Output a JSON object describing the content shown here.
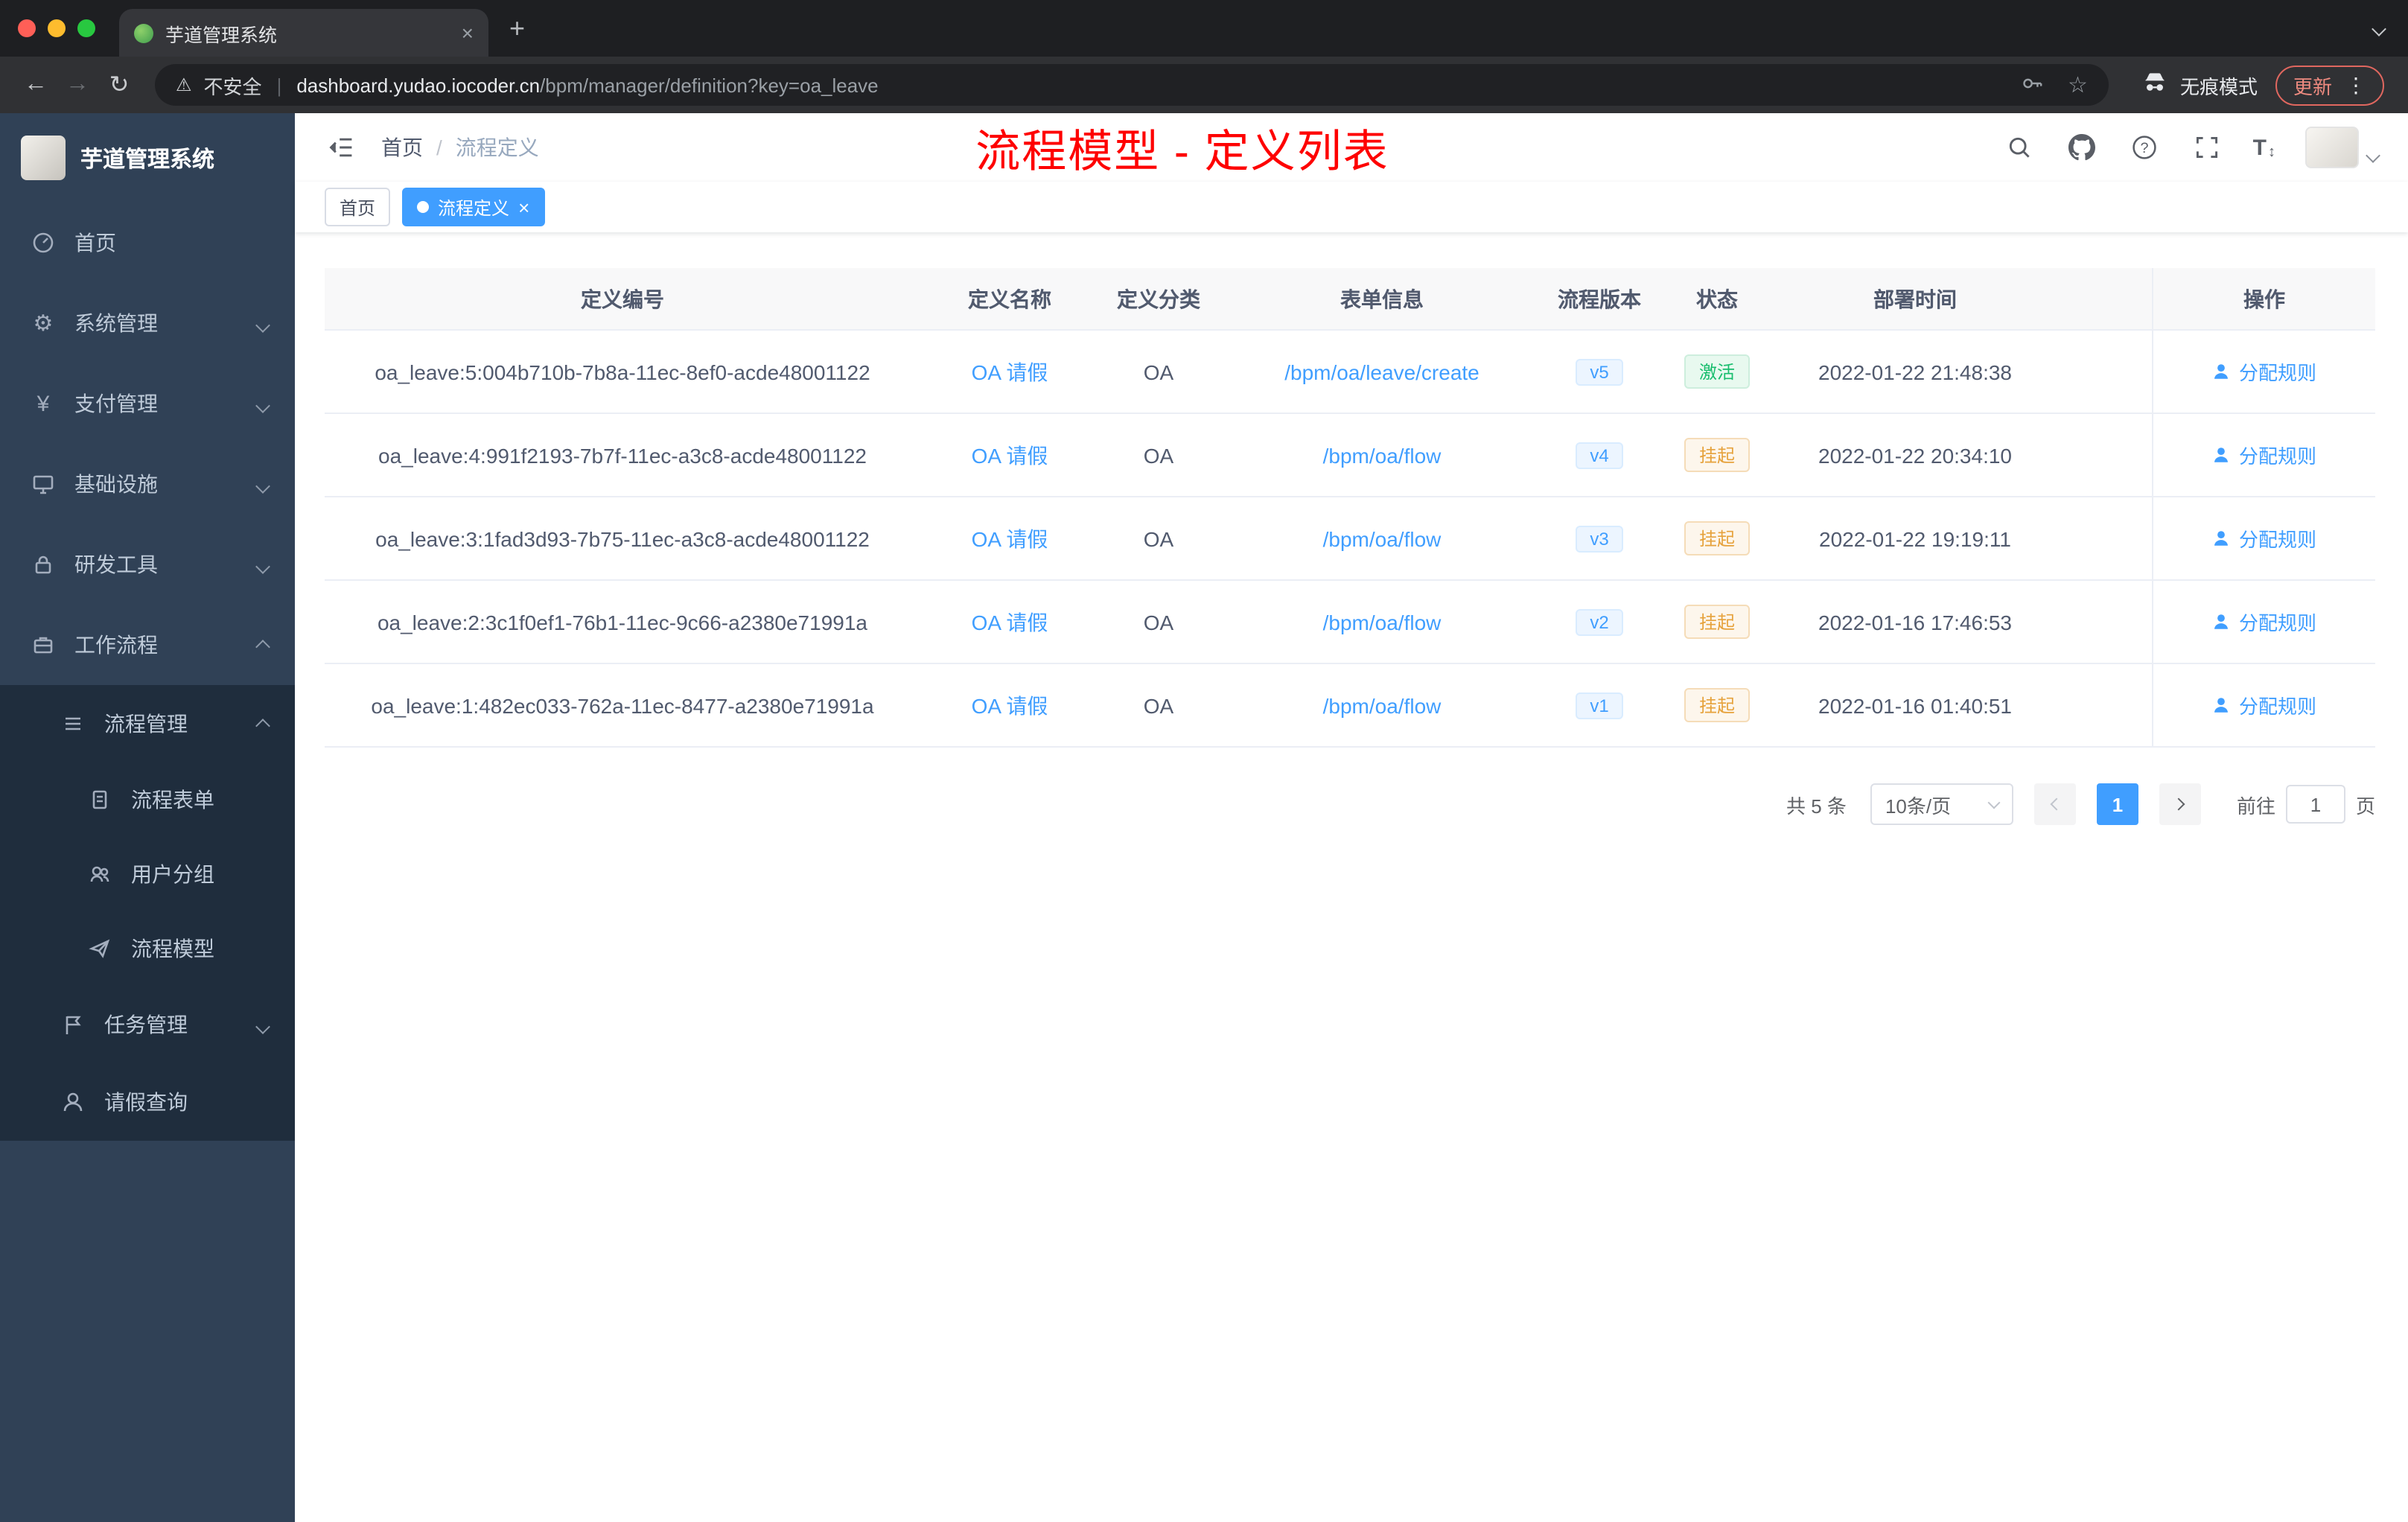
{
  "browser": {
    "tab": {
      "title": "芋道管理系统"
    },
    "address": {
      "security": "不安全",
      "host": "dashboard.yudao.iocoder.cn",
      "path": "/bpm/manager/definition?key=oa_leave",
      "incognito": "无痕模式",
      "update": "更新"
    }
  },
  "icons": {
    "close": "×",
    "plus": "+",
    "back": "←",
    "forward": "→",
    "reload": "↻",
    "warning": "⚠",
    "divider": "|",
    "star": "☆",
    "dots": "⋮",
    "gear": "⚙",
    "yen": "¥",
    "font_size": "T",
    "updown": "↕"
  },
  "sidebar": {
    "logo": "芋道管理系统",
    "items": [
      {
        "label": "首页"
      },
      {
        "label": "系统管理"
      },
      {
        "label": "支付管理"
      },
      {
        "label": "基础设施"
      },
      {
        "label": "研发工具"
      },
      {
        "label": "工作流程"
      },
      {
        "label": "流程管理"
      },
      {
        "label": "流程表单"
      },
      {
        "label": "用户分组"
      },
      {
        "label": "流程模型"
      },
      {
        "label": "任务管理"
      },
      {
        "label": "请假查询"
      }
    ]
  },
  "header": {
    "breadcrumb": [
      "首页",
      "流程定义"
    ],
    "annotation": "流程模型 - 定义列表"
  },
  "tags": {
    "home": "首页",
    "active": "流程定义"
  },
  "table": {
    "columns": [
      "定义编号",
      "定义名称",
      "定义分类",
      "表单信息",
      "流程版本",
      "状态",
      "部署时间",
      "操作"
    ],
    "rows": [
      {
        "id": "oa_leave:5:004b710b-7b8a-11ec-8ef0-acde48001122",
        "name": "OA 请假",
        "category": "OA",
        "form": "/bpm/oa/leave/create",
        "version": "v5",
        "status": "激活",
        "status_type": "success",
        "time": "2022-01-22 21:48:38",
        "action": "分配规则"
      },
      {
        "id": "oa_leave:4:991f2193-7b7f-11ec-a3c8-acde48001122",
        "name": "OA 请假",
        "category": "OA",
        "form": "/bpm/oa/flow",
        "version": "v4",
        "status": "挂起",
        "status_type": "warning",
        "time": "2022-01-22 20:34:10",
        "action": "分配规则"
      },
      {
        "id": "oa_leave:3:1fad3d93-7b75-11ec-a3c8-acde48001122",
        "name": "OA 请假",
        "category": "OA",
        "form": "/bpm/oa/flow",
        "version": "v3",
        "status": "挂起",
        "status_type": "warning",
        "time": "2022-01-22 19:19:11",
        "action": "分配规则"
      },
      {
        "id": "oa_leave:2:3c1f0ef1-76b1-11ec-9c66-a2380e71991a",
        "name": "OA 请假",
        "category": "OA",
        "form": "/bpm/oa/flow",
        "version": "v2",
        "status": "挂起",
        "status_type": "warning",
        "time": "2022-01-16 17:46:53",
        "action": "分配规则"
      },
      {
        "id": "oa_leave:1:482ec033-762a-11ec-8477-a2380e71991a",
        "name": "OA 请假",
        "category": "OA",
        "form": "/bpm/oa/flow",
        "version": "v1",
        "status": "挂起",
        "status_type": "warning",
        "time": "2022-01-16 01:40:51",
        "action": "分配规则"
      }
    ]
  },
  "pagination": {
    "total": "共 5 条",
    "page_size": "10条/页",
    "current": "1",
    "goto_label": "前往",
    "goto_value": "1",
    "page_label": "页"
  },
  "colors": {
    "primary": "#409eff",
    "success": "#18bd6d",
    "warning": "#e6a23c",
    "annotation": "#fe0000",
    "sidebar": "#304156",
    "sidebar_submenu": "#1f2d3d"
  }
}
